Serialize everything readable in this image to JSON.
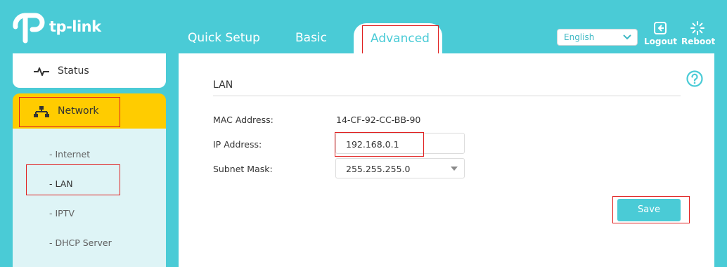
{
  "brand": {
    "name": "tp-link"
  },
  "nav": {
    "tabs": [
      {
        "label": "Quick Setup"
      },
      {
        "label": "Basic"
      },
      {
        "label": "Advanced",
        "active": true
      }
    ]
  },
  "header": {
    "language": "English",
    "logout_label": "Logout",
    "reboot_label": "Reboot"
  },
  "sidebar": {
    "items": [
      {
        "label": "Status",
        "icon": "pulse-icon"
      },
      {
        "label": "Network",
        "icon": "network-icon",
        "active": true
      }
    ],
    "submenu": [
      {
        "label": "- Internet"
      },
      {
        "label": "- LAN",
        "active": true
      },
      {
        "label": "- IPTV"
      },
      {
        "label": "- DHCP Server"
      }
    ]
  },
  "main": {
    "section_title": "LAN",
    "fields": {
      "mac_label": "MAC Address:",
      "mac_value": "14-CF-92-CC-BB-90",
      "ip_label": "IP Address:",
      "ip_value": "192.168.0.1",
      "subnet_label": "Subnet Mask:",
      "subnet_value": "255.255.255.0"
    },
    "save_label": "Save"
  },
  "colors": {
    "brand": "#4acbd6",
    "active_menu": "#ffcc00",
    "submenu_bg": "#def4f6",
    "highlight": "#e02020"
  }
}
